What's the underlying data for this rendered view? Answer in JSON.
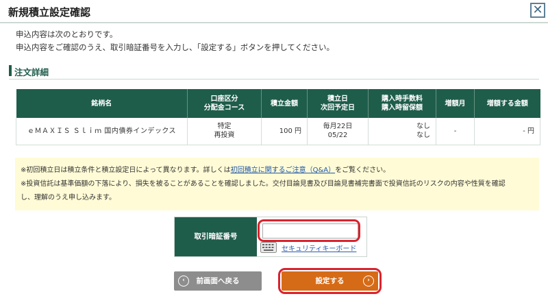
{
  "dialog": {
    "title": "新規積立設定確認",
    "close_symbol": "✕"
  },
  "intro": {
    "line1": "申込内容は次のとおりです。",
    "line2": "申込内容をご確認のうえ、取引暗証番号を入力し、「設定する」ボタンを押してください。"
  },
  "section": {
    "title": "注文詳細"
  },
  "table": {
    "headers": {
      "fund": "銘柄名",
      "account_a": "口座区分",
      "account_b": "分配金コース",
      "amount": "積立金額",
      "date_a": "積立日",
      "date_b": "次回予定日",
      "fee_a": "購入時手数料",
      "fee_b": "購入時留保額",
      "increase_month": "増額月",
      "increase_amount": "増額する金額"
    },
    "row": {
      "fund": "ｅＭＡＸＩＳ Ｓｌｉｍ 国内債券インデックス",
      "account_a": "特定",
      "account_b": "再投資",
      "amount": "100 円",
      "date_a": "毎月22日",
      "date_b": "05/22",
      "fee_a": "なし",
      "fee_b": "なし",
      "increase_month": "-",
      "increase_amount": "- 円"
    }
  },
  "notice": {
    "line1_pre": "※初回積立日は積立条件と積立設定日によって異なります。詳しくは",
    "line1_link": "初回積立に関するご注意（Q&A）",
    "line1_post": "をご覧ください。",
    "line2a": "※投資信託は基準価額の下落により、損失を被ることがあることを確認しました。交付目論見書及び目論見書補完書面で投資信託のリスクの内容や性質を確認",
    "line2b": "し、理解のうえ申し込みます。"
  },
  "pin": {
    "label": "取引暗証番号",
    "value": "",
    "keyboard_link": "セキュリティキーボード",
    "keyboard_icon": "keyboard-icon"
  },
  "buttons": {
    "back_label": "前画面へ戻る",
    "submit_label": "設定する",
    "back_icon": "‹",
    "submit_icon": "›"
  },
  "colors": {
    "header_green": "#1f5d4b",
    "submit_orange": "#d66b17",
    "back_gray": "#8d8d8d",
    "notice_yellow": "#fffbd6",
    "highlight_red": "#d9232d"
  }
}
